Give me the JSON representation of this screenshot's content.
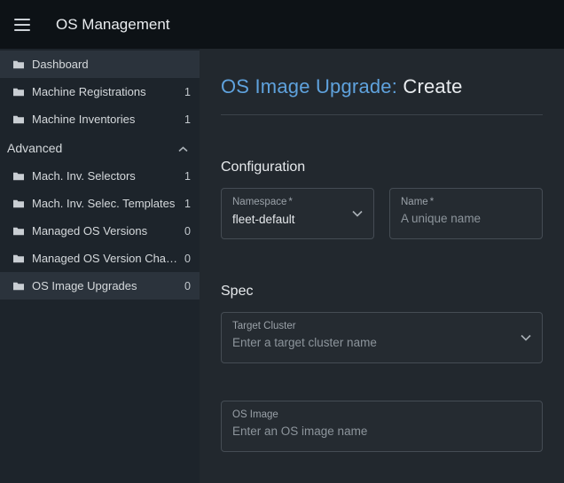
{
  "header": {
    "title": "OS Management"
  },
  "sidebar": {
    "items": [
      {
        "label": "Dashboard",
        "count": ""
      },
      {
        "label": "Machine Registrations",
        "count": "1"
      },
      {
        "label": "Machine Inventories",
        "count": "1"
      }
    ],
    "advanced_label": "Advanced",
    "advanced_items": [
      {
        "label": "Mach. Inv. Selectors",
        "count": "1"
      },
      {
        "label": "Mach. Inv. Selec. Templates",
        "count": "1"
      },
      {
        "label": "Managed OS Versions",
        "count": "0"
      },
      {
        "label": "Managed OS Version Channels",
        "count": "0"
      },
      {
        "label": "OS Image Upgrades",
        "count": "0"
      }
    ]
  },
  "main": {
    "title_prefix": "OS Image Upgrade:",
    "title_suffix": "Create",
    "configuration": {
      "heading": "Configuration",
      "namespace": {
        "label": "Namespace",
        "required": "*",
        "value": "fleet-default"
      },
      "name": {
        "label": "Name",
        "required": "*",
        "placeholder": "A unique name"
      }
    },
    "spec": {
      "heading": "Spec",
      "target_cluster": {
        "label": "Target Cluster",
        "placeholder": "Enter a target cluster name"
      },
      "os_image": {
        "label": "OS Image",
        "placeholder": "Enter an OS image name"
      }
    }
  },
  "colors": {
    "accent_blue": "#5fa2dd",
    "topbar_bg": "#0d1216",
    "sidebar_bg": "#1d242b",
    "sidebar_selected_bg": "#2b333c",
    "main_bg": "#22282e"
  }
}
